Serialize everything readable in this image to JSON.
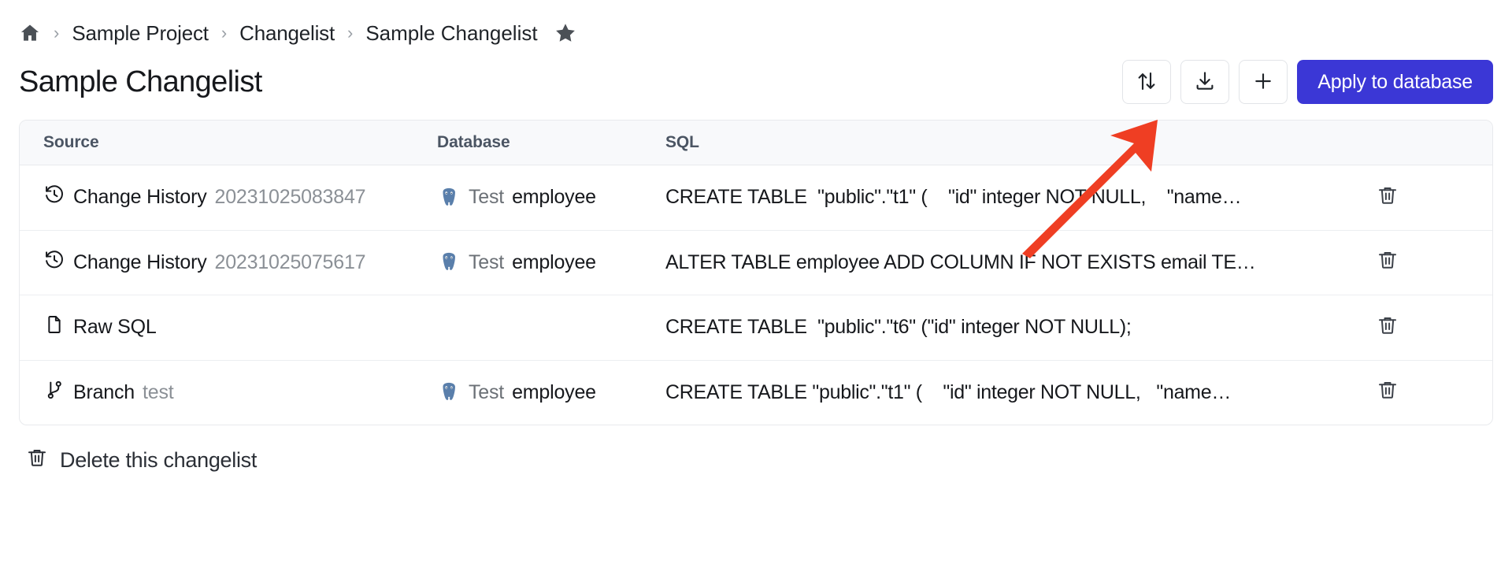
{
  "breadcrumb": {
    "home_icon": "home-icon",
    "separator": "›",
    "items": [
      {
        "label": "Sample Project"
      },
      {
        "label": "Changelist"
      },
      {
        "label": "Sample Changelist"
      }
    ],
    "star_icon": "star-filled-icon"
  },
  "header": {
    "title": "Sample Changelist",
    "buttons": [
      {
        "name": "reorder-button",
        "icon": "up-down-arrows-icon"
      },
      {
        "name": "export-button",
        "icon": "download-icon"
      },
      {
        "name": "add-button",
        "icon": "plus-icon"
      }
    ],
    "primary_action": "Apply to database",
    "primary_color": "#3b37d6"
  },
  "table": {
    "columns": [
      "Source",
      "Database",
      "SQL",
      ""
    ],
    "rows": [
      {
        "source_icon": "history-icon",
        "source_label": "Change History",
        "source_detail": "20231025083847",
        "db_icon": "postgresql-icon",
        "db_env": "Test",
        "db_name": "employee",
        "sql": "CREATE TABLE  \"public\".\"t1\" (    \"id\" integer NOT NULL,    \"name…",
        "delete_icon": "trash-icon"
      },
      {
        "source_icon": "history-icon",
        "source_label": "Change History",
        "source_detail": "20231025075617",
        "db_icon": "postgresql-icon",
        "db_env": "Test",
        "db_name": "employee",
        "sql": "ALTER TABLE employee ADD COLUMN IF NOT EXISTS email TE…",
        "delete_icon": "trash-icon"
      },
      {
        "source_icon": "file-icon",
        "source_label": "Raw SQL",
        "source_detail": "",
        "db_icon": "",
        "db_env": "",
        "db_name": "",
        "sql": "CREATE TABLE  \"public\".\"t6\" (\"id\" integer NOT NULL);",
        "delete_icon": "trash-icon"
      },
      {
        "source_icon": "branch-icon",
        "source_label": "Branch",
        "source_detail": "test",
        "db_icon": "postgresql-icon",
        "db_env": "Test",
        "db_name": "employee",
        "sql": "CREATE TABLE \"public\".\"t1\" (    \"id\" integer NOT NULL,   \"name…",
        "delete_icon": "trash-icon"
      }
    ]
  },
  "footer": {
    "delete_icon": "trash-icon",
    "delete_label": "Delete this changelist"
  },
  "annotation": {
    "type": "arrow",
    "color": "#ef3e23",
    "points_to": "export-button"
  }
}
